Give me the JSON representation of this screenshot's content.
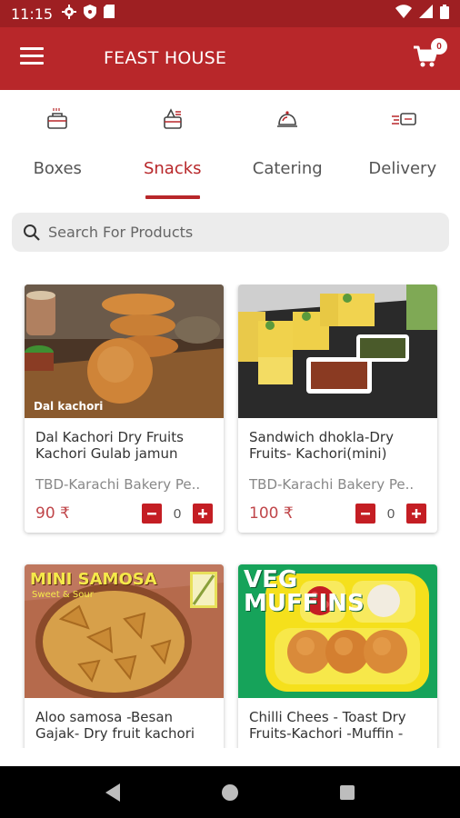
{
  "status_bar": {
    "time": "11:15"
  },
  "app_bar": {
    "title": "FEAST HOUSE",
    "cart_count": "0"
  },
  "tabs": [
    {
      "label": "Boxes",
      "icon": "lunchbox-icon"
    },
    {
      "label": "Snacks",
      "icon": "snacks-icon",
      "active": true
    },
    {
      "label": "Catering",
      "icon": "cloche-icon"
    },
    {
      "label": "Delivery",
      "icon": "delivery-icon"
    }
  ],
  "search": {
    "placeholder": "Search For Products"
  },
  "products": [
    {
      "name": "Dal Kachori Dry Fruits Kachori Gulab jamun",
      "store": "TBD-Karachi Bakery Pe..",
      "price": "90 ₹",
      "qty": "0",
      "image_caption": "Dal kachori"
    },
    {
      "name": "Sandwich dhokla-Dry Fruits- Kachori(mini)",
      "store": "TBD-Karachi Bakery Pe..",
      "price": "100 ₹",
      "qty": "0"
    },
    {
      "name": "Aloo samosa -Besan Gajak- Dry fruit kachori",
      "image_caption": "MINI SAMOSA",
      "image_subcaption": "Sweet & Sour"
    },
    {
      "name": "Chilli Chees - Toast Dry Fruits-Kachori -Muffin -",
      "image_caption": "VEG MUFFINS"
    }
  ],
  "colors": {
    "primary": "#b8272a",
    "status_bar": "#9e1f22",
    "qty_button": "#c41e24"
  }
}
